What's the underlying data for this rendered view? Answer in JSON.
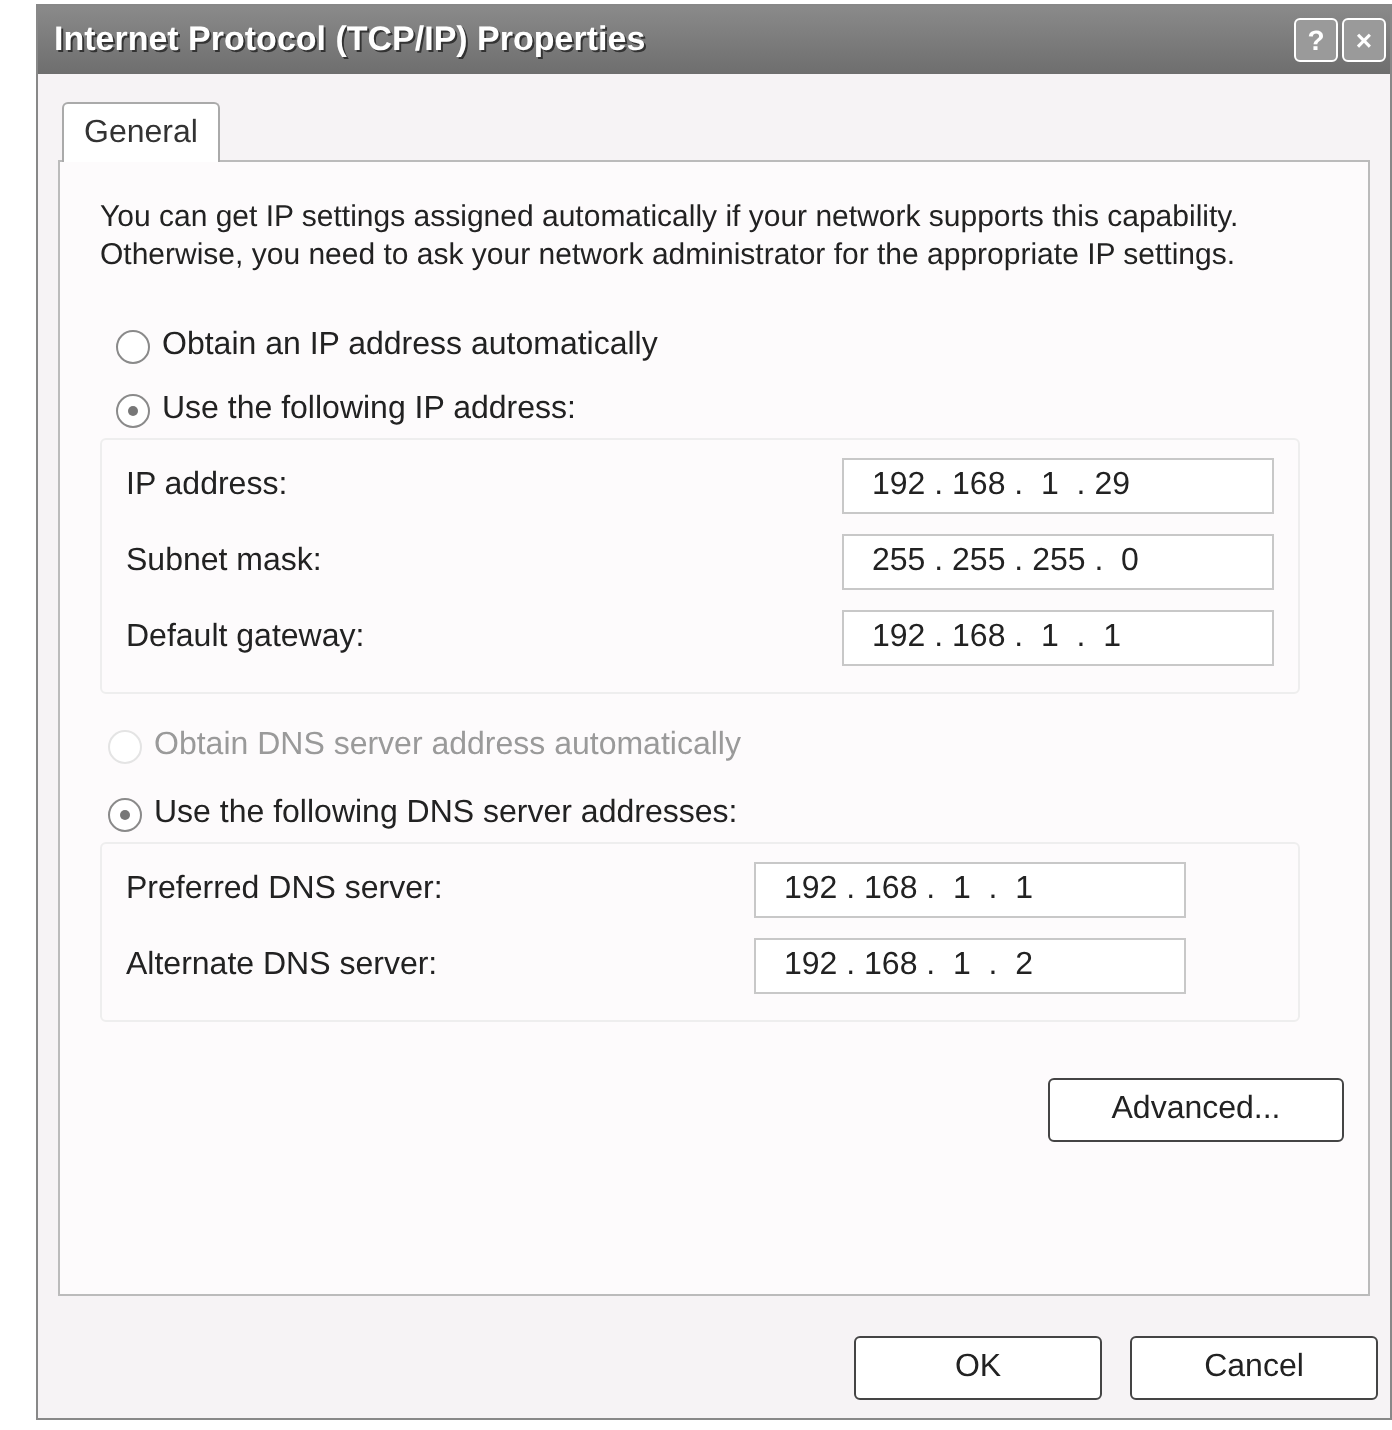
{
  "window": {
    "title": "Internet Protocol (TCP/IP) Properties",
    "title_buttons": [
      "?",
      "×"
    ]
  },
  "tabs": [
    {
      "label": "General",
      "selected": true
    }
  ],
  "description": "You can get IP settings assigned automatically if your network supports this capability. Otherwise, you need to ask your network administrator for the appropriate IP settings.",
  "ip_options": [
    {
      "label": "Obtain an IP address automatically",
      "selected": false,
      "disabled": false
    },
    {
      "label": "Use the following IP address:",
      "selected": true,
      "disabled": false
    }
  ],
  "ip_fields": [
    {
      "label": "IP address:",
      "value": "192 . 168 .  1  . 29"
    },
    {
      "label": "Subnet mask:",
      "value": "255 . 255 . 255 .  0"
    },
    {
      "label": "Default gateway:",
      "value": "192 . 168 .  1  .  1"
    }
  ],
  "dns_options": [
    {
      "label": "Obtain DNS server address automatically",
      "selected": false,
      "disabled": true
    },
    {
      "label": "Use the following DNS server addresses:",
      "selected": true,
      "disabled": false
    }
  ],
  "dns_fields": [
    {
      "label": "Preferred DNS server:",
      "value": "192 . 168 .  1  .  1"
    },
    {
      "label": "Alternate DNS server:",
      "value": "192 . 168 .  1  .  2"
    }
  ],
  "advanced_button": "Advanced...",
  "buttons": [
    "OK",
    "Cancel"
  ]
}
